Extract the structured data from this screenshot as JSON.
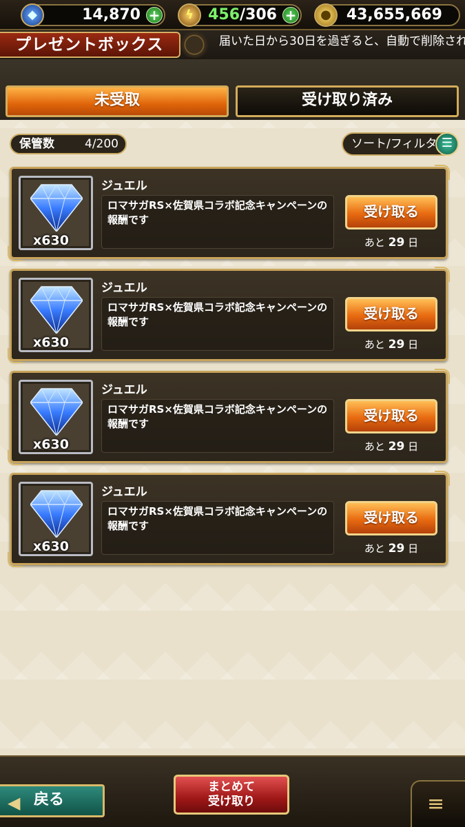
{
  "resources": {
    "jewel": {
      "value": "14,870",
      "plus": "+"
    },
    "stamina": {
      "current": "456",
      "separator": "/",
      "max": "306",
      "plus": "+"
    },
    "gold": {
      "value": "43,655,669"
    }
  },
  "header": {
    "title": "プレゼントボックス",
    "notice": "届いた日から30日を過ぎると、自動で削除され"
  },
  "tabs": [
    {
      "label": "未受取",
      "active": true
    },
    {
      "label": "受け取り済み",
      "active": false
    }
  ],
  "storage": {
    "label": "保管数",
    "count": "4/200"
  },
  "sort_filter": {
    "label": "ソート/フィルタ"
  },
  "gifts": [
    {
      "name": "ジュエル",
      "quantity": "x630",
      "description": "ロマサガRS×佐賀県コラボ記念キャンペーンの報酬です",
      "button": "受け取る",
      "remain_prefix": "あと",
      "remain_days": "29",
      "remain_unit": "日"
    },
    {
      "name": "ジュエル",
      "quantity": "x630",
      "description": "ロマサガRS×佐賀県コラボ記念キャンペーンの報酬です",
      "button": "受け取る",
      "remain_prefix": "あと",
      "remain_days": "29",
      "remain_unit": "日"
    },
    {
      "name": "ジュエル",
      "quantity": "x630",
      "description": "ロマサガRS×佐賀県コラボ記念キャンペーンの報酬です",
      "button": "受け取る",
      "remain_prefix": "あと",
      "remain_days": "29",
      "remain_unit": "日"
    },
    {
      "name": "ジュエル",
      "quantity": "x630",
      "description": "ロマサガRS×佐賀県コラボ記念キャンペーンの報酬です",
      "button": "受け取る",
      "remain_prefix": "あと",
      "remain_days": "29",
      "remain_unit": "日"
    }
  ],
  "footer": {
    "back_label": "戻る",
    "bulk_line1": "まとめて",
    "bulk_line2": "受け取り"
  },
  "icons": {
    "jewel": "diamond-icon",
    "stamina": "lightning-icon",
    "gold": "coin-icon",
    "menu": "hamburger-icon"
  },
  "colors": {
    "active_tab": "#e0650a",
    "receive_button": "#e86a10",
    "back_button": "#2e8a7c",
    "bulk_button": "#a01818"
  }
}
